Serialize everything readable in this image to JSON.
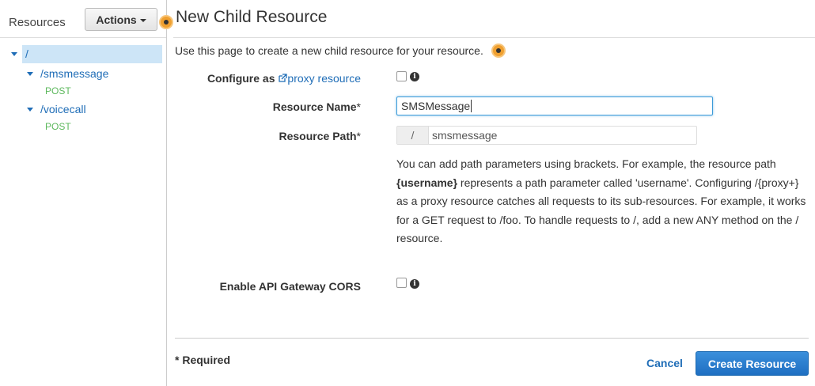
{
  "sidebar": {
    "title": "Resources",
    "actions_label": "Actions",
    "tree": [
      {
        "label": "/"
      },
      {
        "label": "/smsmessage",
        "method": "POST"
      },
      {
        "label": "/voicecall",
        "method": "POST"
      }
    ]
  },
  "main": {
    "title": "New Child Resource",
    "intro": "Use this page to create a new child resource for your resource.",
    "configure_as_label": "Configure as",
    "proxy_link": "proxy resource",
    "proxy_checked": false,
    "resource_name_label": "Resource Name",
    "resource_name_value": "SMSMessage",
    "resource_path_label": "Resource Path",
    "resource_path_prefix": "/",
    "resource_path_value": "smsmessage",
    "required_marker": "*",
    "help_text_1": "You can add path parameters using brackets. For example, the resource path ",
    "help_text_param": "{username}",
    "help_text_2": " represents a path parameter called 'username'. Configuring /{proxy+} as a proxy resource catches all requests to its sub-resources. For example, it works for a GET request to /foo. To handle requests to /, add a new ANY method on the / resource.",
    "cors_label": "Enable API Gateway CORS",
    "cors_checked": false,
    "required_note": "* Required",
    "cancel_label": "Cancel",
    "create_label": "Create Resource"
  },
  "colors": {
    "link": "#1f6db7",
    "method": "#5cb85c",
    "primary_button": "#2a7fd0",
    "selected_row": "#cde5f7"
  },
  "icons": [
    "chevron-down-icon",
    "external-link-icon",
    "info-icon",
    "hotspot-indicator"
  ]
}
